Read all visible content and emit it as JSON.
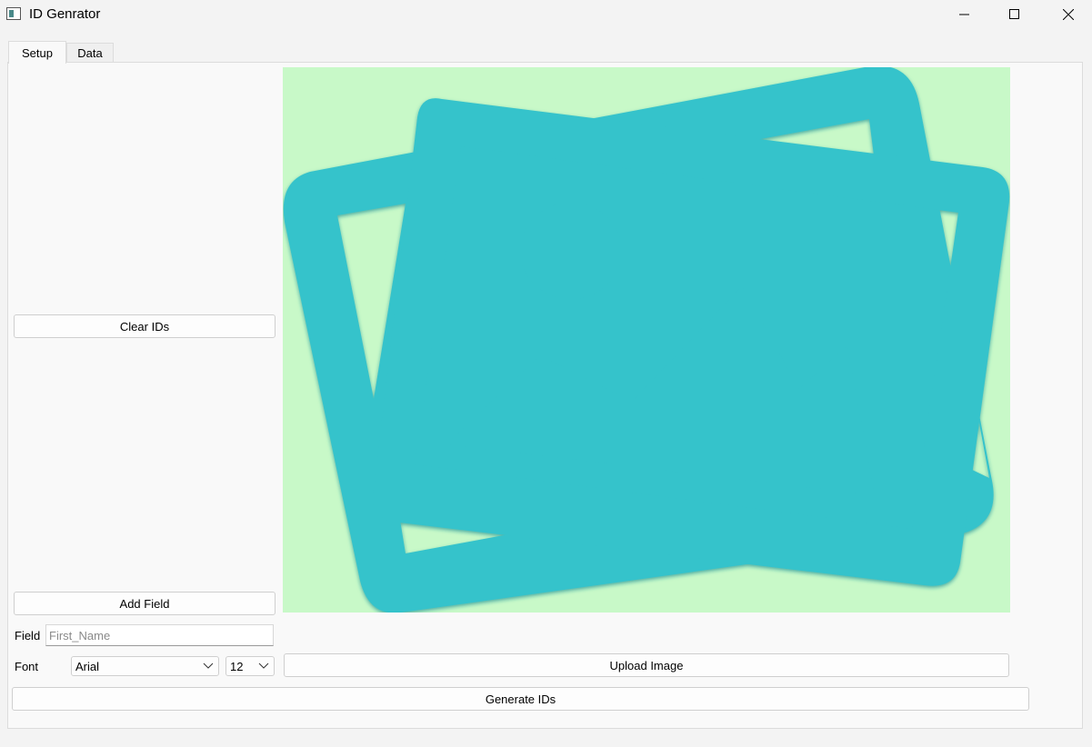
{
  "window": {
    "title": "ID Genrator"
  },
  "tabs": [
    {
      "label": "Setup",
      "active": true
    },
    {
      "label": "Data",
      "active": false
    }
  ],
  "buttons": {
    "clear_ids": "Clear IDs",
    "add_field": "Add Field",
    "upload_image": "Upload Image",
    "generate_ids": "Generate IDs"
  },
  "field": {
    "label": "Field",
    "value": "",
    "placeholder": "First_Name"
  },
  "font": {
    "label": "Font",
    "family": "Arial",
    "size": "12"
  },
  "preview": {
    "icon": "image-placeholder-icon",
    "background": "#c8f9c8",
    "icon_color": "#36c3cb"
  }
}
